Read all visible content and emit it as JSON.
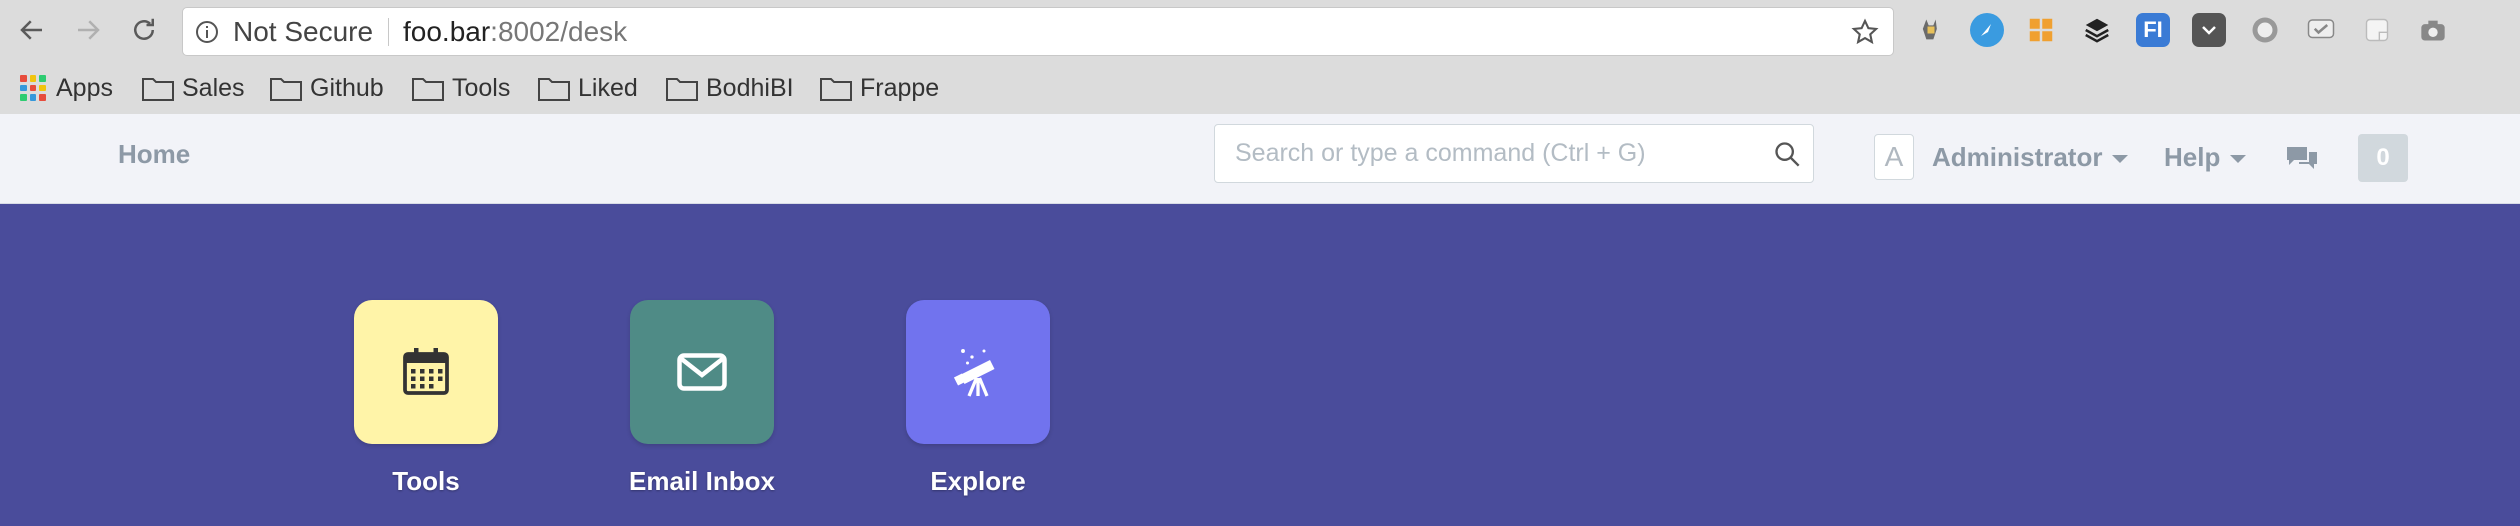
{
  "browser": {
    "security_label": "Not Secure",
    "url_host": "foo.bar",
    "url_path": ":8002/desk",
    "extensions": [
      "bat-icon",
      "compass-icon",
      "boxes-icon",
      "layers-icon",
      "fi-icon",
      "pocket-icon",
      "circle-icon",
      "chat-check-icon",
      "note-icon",
      "camera-icon"
    ]
  },
  "bookmarks": [
    {
      "label": "Apps",
      "icon": "apps-grid-icon"
    },
    {
      "label": "Sales",
      "icon": "folder-icon"
    },
    {
      "label": "Github",
      "icon": "folder-icon"
    },
    {
      "label": "Tools",
      "icon": "folder-icon"
    },
    {
      "label": "Liked",
      "icon": "folder-icon"
    },
    {
      "label": "BodhiBI",
      "icon": "folder-icon"
    },
    {
      "label": "Frappe",
      "icon": "folder-icon"
    }
  ],
  "navbar": {
    "home_label": "Home",
    "search_placeholder": "Search or type a command (Ctrl + G)",
    "avatar_letter": "A",
    "user_label": "Administrator",
    "help_label": "Help",
    "notification_count": "0"
  },
  "modules": [
    {
      "label": "Tools",
      "icon": "calendar-icon",
      "color": "#fff4a8"
    },
    {
      "label": "Email Inbox",
      "icon": "envelope-icon",
      "color": "#4f8b86"
    },
    {
      "label": "Explore",
      "icon": "telescope-icon",
      "color": "#7173ee"
    }
  ],
  "colors": {
    "desk_background": "#4a4c9b",
    "navbar_background": "#f2f3f8",
    "chrome_background": "#dcdcdc"
  }
}
